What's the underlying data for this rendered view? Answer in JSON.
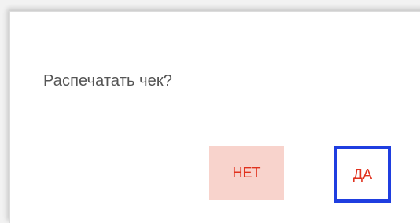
{
  "dialog": {
    "message": "Распечатать чек?",
    "buttons": {
      "no_label": "НЕТ",
      "yes_label": "ДА"
    }
  },
  "colors": {
    "button_text": "#e0321e",
    "no_button_bg": "#f8d3cc",
    "yes_button_focus_border": "#1f3ee0",
    "message_text": "#555555"
  }
}
